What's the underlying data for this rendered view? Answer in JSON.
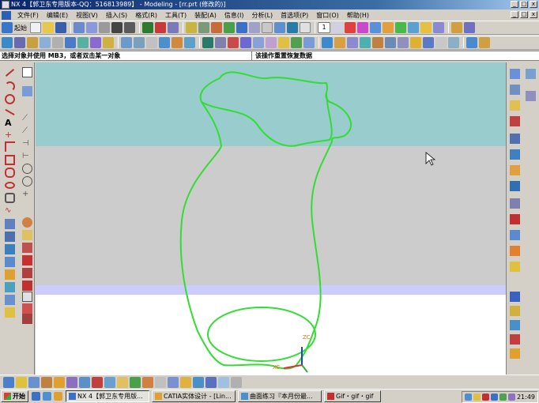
{
  "window": {
    "title": "NX 4【郭卫东专用版本-QQ：516813989】 - Modeling - [rr.prt (修改的)]",
    "controls": [
      "_",
      "□",
      "x"
    ]
  },
  "menu": {
    "items": [
      "文件(F)",
      "编辑(E)",
      "视图(V)",
      "插入(S)",
      "格式(R)",
      "工具(T)",
      "装配(A)",
      "信息(I)",
      "分析(L)",
      "首选项(P)",
      "窗口(O)",
      "帮助(H)"
    ],
    "doc_controls": [
      "_",
      "□",
      "x"
    ]
  },
  "toolbar": {
    "start_label": "起始",
    "layer_value": "1"
  },
  "cue": {
    "prompt": "选择对象并使用 MB3，或者双击某一对象",
    "status": "该操作重置恢复数据"
  },
  "viewport": {
    "background_colors": [
      "#99cccc",
      "#cccccc",
      "#ccccff",
      "#ffffff"
    ],
    "curve_color": "#33dd33",
    "axes": {
      "z_label": "ZC",
      "x_label": "XC"
    }
  },
  "taskbar": {
    "start_label": "开始",
    "tasks": [
      "NX 4【郭卫东专用版...",
      "CATIA实体设计 - [Lin...",
      "曲面练习『本月份最...",
      "Gif・gif・gif"
    ],
    "clock": "21:49"
  }
}
